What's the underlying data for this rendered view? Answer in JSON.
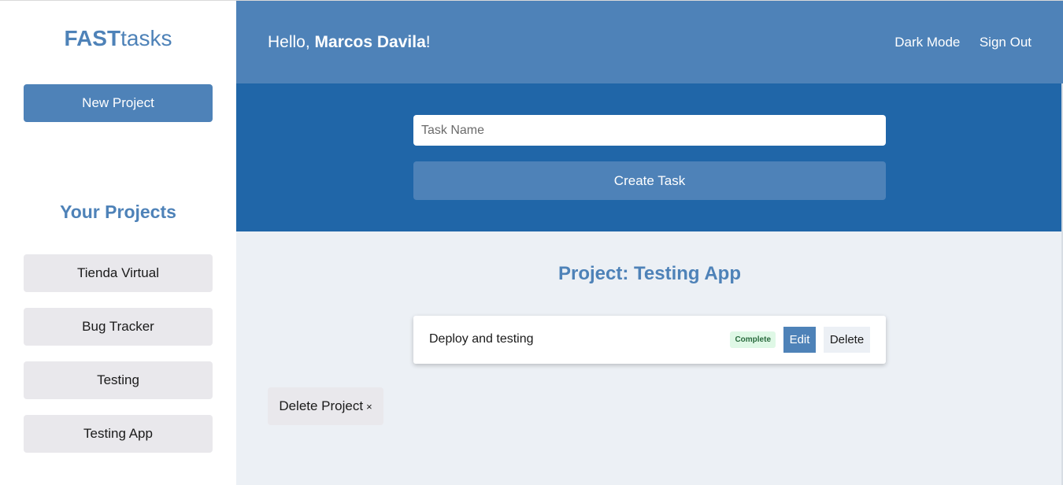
{
  "sidebar": {
    "logo_bold": "FAST",
    "logo_light": "tasks",
    "new_project_label": "New Project",
    "projects_heading": "Your Projects",
    "projects": [
      {
        "label": "Tienda Virtual"
      },
      {
        "label": "Bug Tracker"
      },
      {
        "label": "Testing"
      },
      {
        "label": "Testing App"
      }
    ]
  },
  "header": {
    "greeting_prefix": "Hello, ",
    "user_name": "Marcos Davila",
    "greeting_suffix": "!",
    "dark_mode_label": "Dark Mode",
    "sign_out_label": "Sign Out"
  },
  "task_form": {
    "input_placeholder": "Task Name",
    "input_value": "",
    "create_label": "Create Task"
  },
  "project": {
    "title": "Project: Testing App",
    "tasks": [
      {
        "name": "Deploy and testing",
        "status": "Complete",
        "edit_label": "Edit",
        "delete_label": "Delete"
      }
    ],
    "delete_project_label": "Delete Project",
    "delete_project_icon": "×"
  },
  "colors": {
    "primary": "#4e82b8",
    "header_dark": "#2066a8",
    "background": "#ecf0f5",
    "complete_badge": "#dff8e6"
  }
}
